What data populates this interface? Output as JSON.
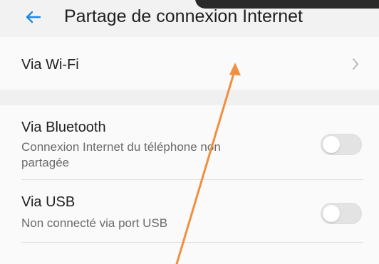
{
  "header": {
    "title": "Partage de connexion Internet",
    "back_icon": "back-arrow-icon",
    "accent_color": "#1e88e5"
  },
  "settings": {
    "wifi": {
      "label": "Via Wi-Fi",
      "chevron_icon": "chevron-right-icon"
    },
    "bluetooth": {
      "label": "Via Bluetooth",
      "subtitle": "Connexion Internet du téléphone non partagée",
      "enabled": false
    },
    "usb": {
      "label": "Via USB",
      "subtitle": "Non connecté via port USB",
      "enabled": false
    }
  },
  "annotation": {
    "type": "arrow",
    "icon": "annotation-arrow",
    "color": "#ef8f3f"
  }
}
